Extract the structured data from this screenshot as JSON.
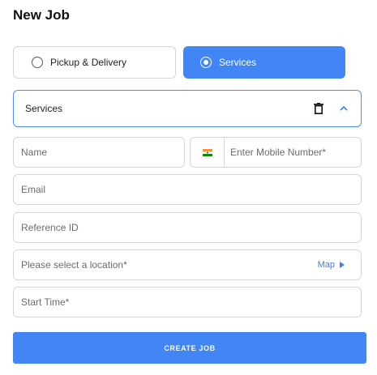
{
  "header": {
    "title": "New Job"
  },
  "job_type": {
    "options": [
      {
        "label": "Pickup & Delivery",
        "selected": false
      },
      {
        "label": "Services",
        "selected": true
      }
    ]
  },
  "accordion": {
    "label": "Services",
    "icons": [
      "trash-icon",
      "chevron-up-icon"
    ]
  },
  "form": {
    "name": {
      "placeholder": "Name",
      "value": ""
    },
    "mobile": {
      "placeholder": "Enter Mobile Number*",
      "value": "",
      "country_flag": "india-flag-icon"
    },
    "email": {
      "placeholder": "Email",
      "value": ""
    },
    "reference_id": {
      "placeholder": "Reference ID",
      "value": ""
    },
    "location": {
      "placeholder": "Please select a location*",
      "value": "",
      "map_label": "Map"
    },
    "start_time": {
      "placeholder": "Start Time*",
      "value": ""
    }
  },
  "actions": {
    "create_label": "CREATE JOB"
  },
  "colors": {
    "accent": "#4285f4",
    "border": "#d6d6d6",
    "link": "#3b7ff0"
  }
}
